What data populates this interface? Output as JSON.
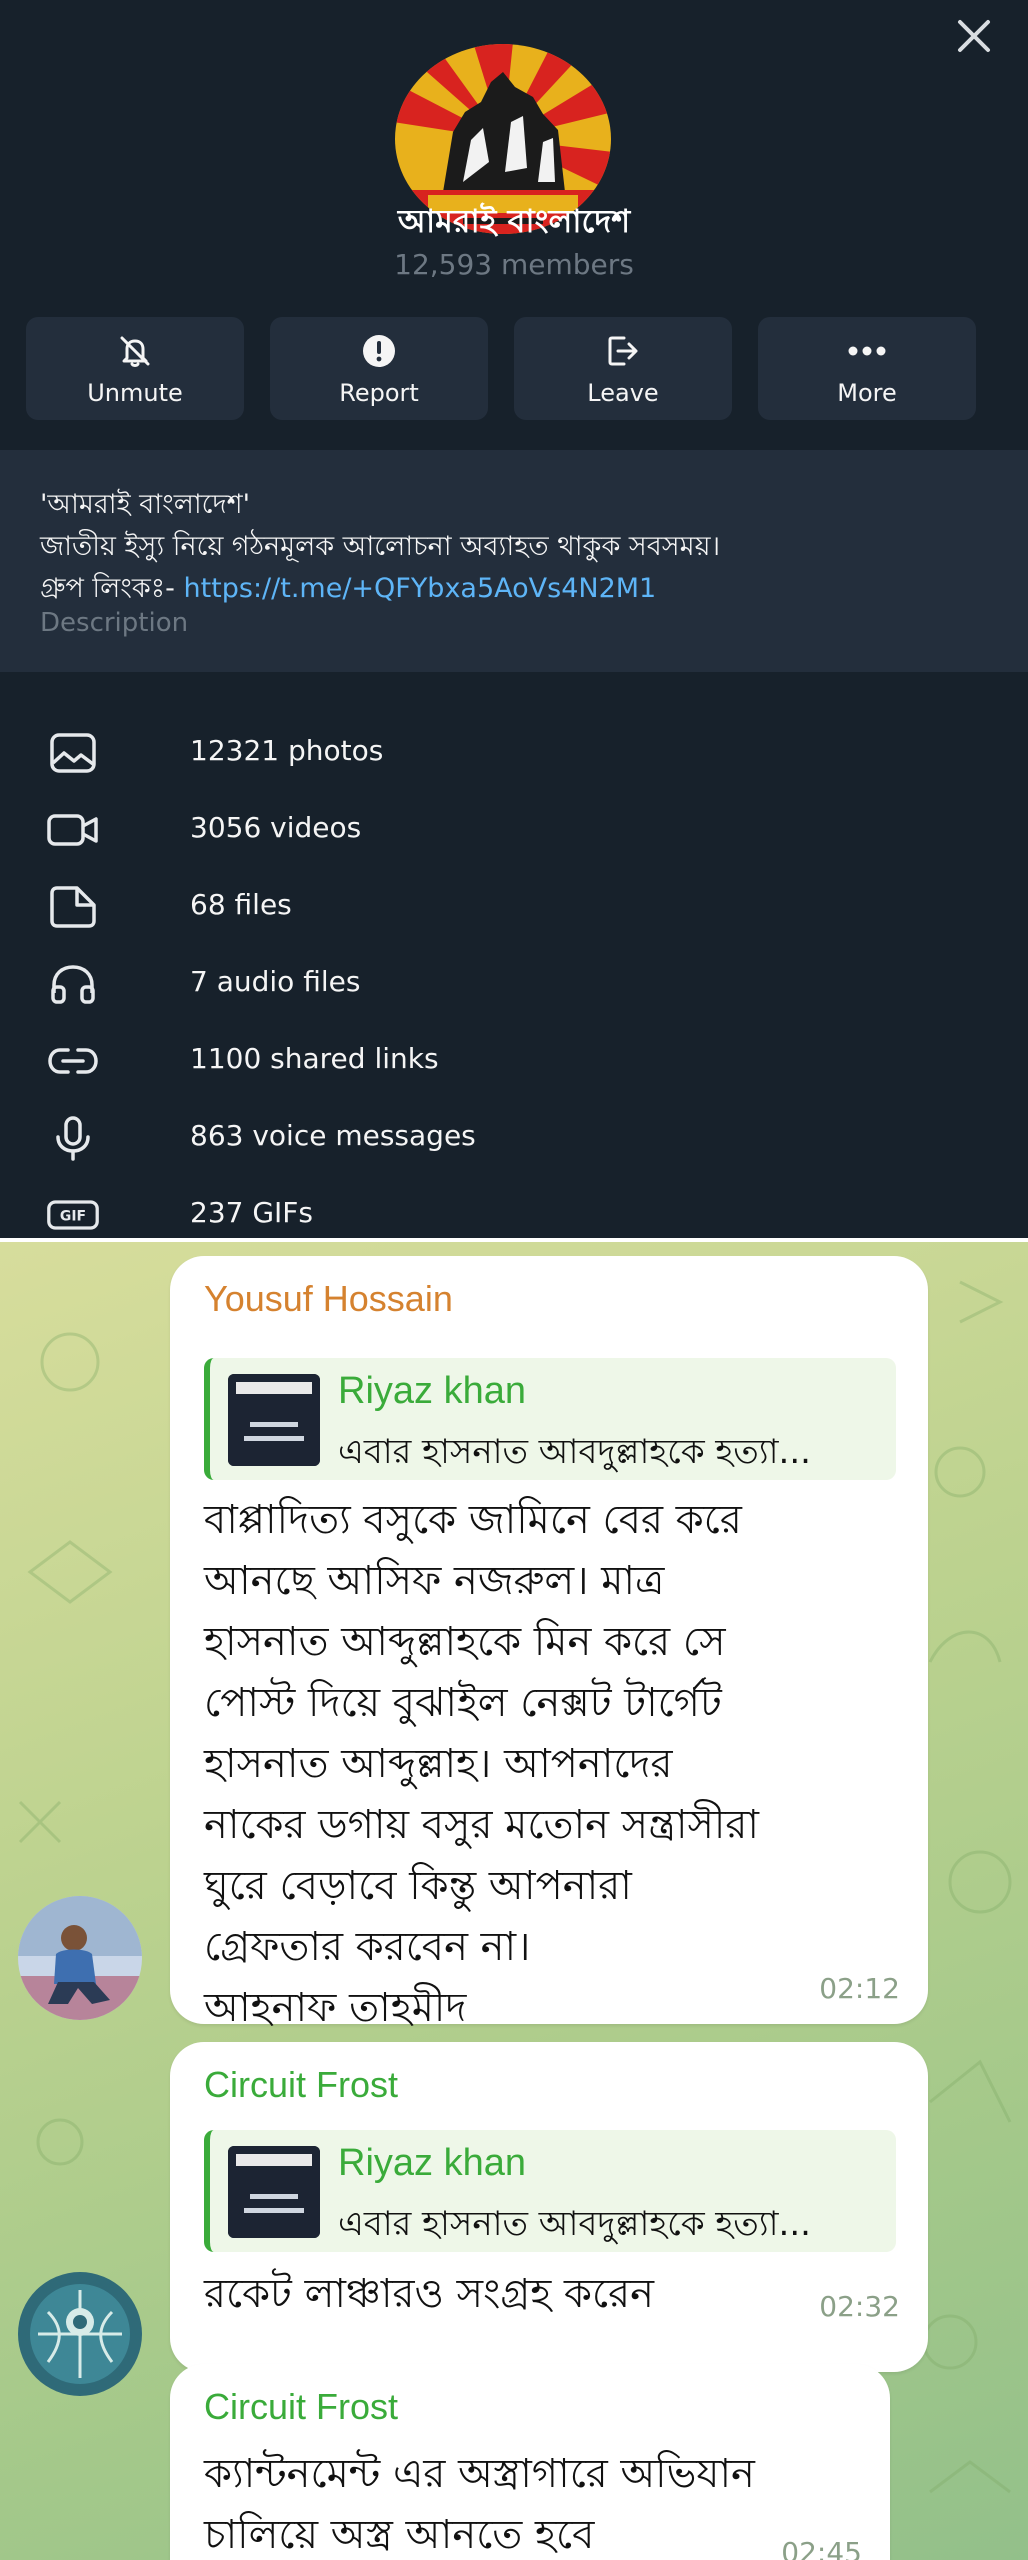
{
  "group": {
    "title": "আমরাই বাংলাদেশ",
    "members": "12,593 members"
  },
  "actions": [
    {
      "label": "Unmute",
      "icon": "bell-off-icon"
    },
    {
      "label": "Report",
      "icon": "alert-icon"
    },
    {
      "label": "Leave",
      "icon": "leave-icon"
    },
    {
      "label": "More",
      "icon": "more-icon"
    }
  ],
  "description": {
    "line1": "'আমরাই বাংলাদেশ'",
    "line2": "জাতীয় ইস্যু নিয়ে গঠনমূলক আলোচনা অব্যাহত থাকুক সবসময়।",
    "line3_prefix": "গ্রুপ লিংকঃ- ",
    "link": "https://t.me/+QFYbxa5AoVs4N2M1",
    "caption": "Description"
  },
  "media": [
    {
      "label": "12321 photos",
      "icon": "photo-icon"
    },
    {
      "label": "3056 videos",
      "icon": "video-icon"
    },
    {
      "label": "68 files",
      "icon": "file-icon"
    },
    {
      "label": "7 audio files",
      "icon": "headphones-icon"
    },
    {
      "label": "1100 shared links",
      "icon": "link-icon"
    },
    {
      "label": "863 voice messages",
      "icon": "microphone-icon"
    },
    {
      "label": "237 GIFs",
      "icon": "gif-icon"
    }
  ],
  "chat": {
    "messages": [
      {
        "sender": "Yousuf Hossain",
        "sender_color": "#d5822f",
        "reply_name": "Riyaz khan",
        "reply_text": "এবার হাসনাত আবদুল্লাহকে হত্যা...",
        "text": "বাপ্পাদিত্য বসুকে জামিনে বের করে\nআনছে আসিফ নজরুল। মাত্র\nহাসনাত আব্দুল্লাহকে মিন করে সে\nপোস্ট দিয়ে বুঝাইল নেক্সট টার্গেট\nহাসনাত আব্দুল্লাহ। আপনাদের\nনাকের ডগায় বসুর মতোন সন্ত্রাসীরা\nঘুরে বেড়াবে কিন্তু আপনারা\nগ্রেফতার করবেন না।\nআহনাফ তাহমীদ",
        "time": "02:12"
      },
      {
        "sender": "Circuit Frost",
        "sender_color": "#3aab3a",
        "reply_name": "Riyaz khan",
        "reply_text": "এবার হাসনাত আবদুল্লাহকে হত্যা...",
        "text": "রকেট লাঞ্চারও সংগ্রহ করেন",
        "time": "02:32"
      },
      {
        "sender": "Circuit Frost",
        "sender_color": "#3aab3a",
        "text": "ক্যান্টনমেন্ট এর অস্ত্রাগারে অভিযান\nচালিয়ে অস্ত্র আনতে হবে",
        "time": "02:45"
      }
    ]
  },
  "colors": {
    "panel_bg": "#17212b",
    "card_bg": "#232e3c",
    "link": "#5eb5f7",
    "muted": "#6d7883"
  }
}
